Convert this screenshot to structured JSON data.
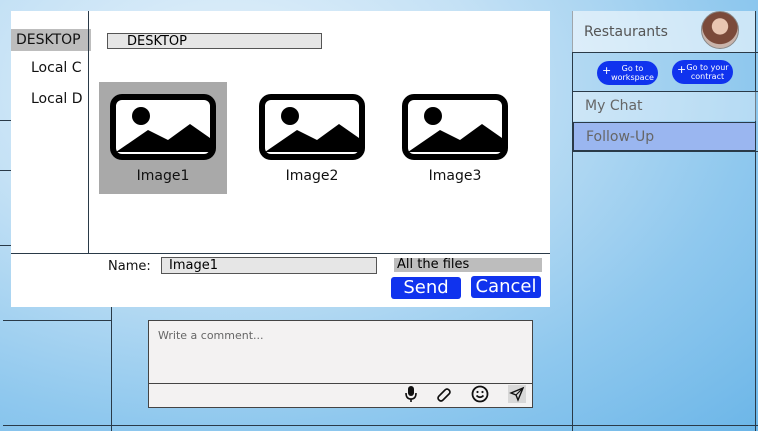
{
  "right_panel": {
    "title": "Restaurants",
    "workspace_button": "Go to workspace",
    "contract_button": "Go to your contract",
    "menu": [
      "My Chat",
      "Follow-Up"
    ]
  },
  "dialog": {
    "sidebar": [
      "DESKTOP",
      "Local C",
      "Local D"
    ],
    "path": "DESKTOP",
    "files": [
      "Image1",
      "Image2",
      "Image3"
    ],
    "name_label": "Name:",
    "name_value": "Image1",
    "filter": "All the files",
    "send": "Send",
    "cancel": "Cancel"
  },
  "comment": {
    "placeholder": "Write a comment..."
  },
  "colors": {
    "accent": "#1033ee",
    "selected_menu": "#9ab6f0"
  }
}
